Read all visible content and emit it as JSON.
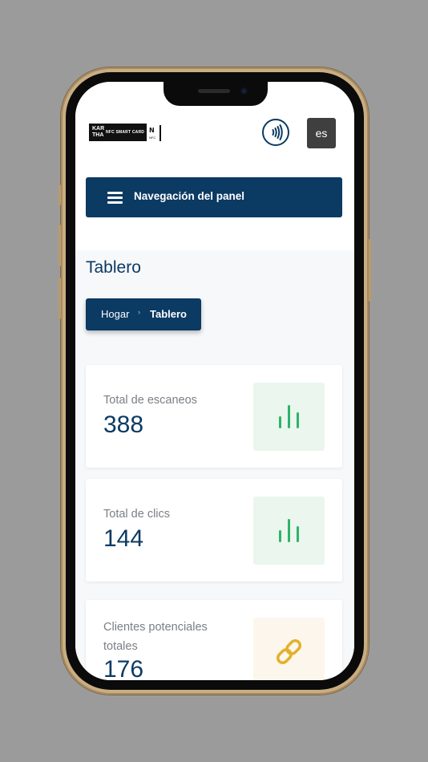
{
  "header": {
    "logo_text_line1": "KAR",
    "logo_text_line2": "THA",
    "logo_tagline": "NFC SMART CARD",
    "nfc_mark": "N",
    "nfc_mark_caption": "NFC",
    "language": "es"
  },
  "nav": {
    "title": "Navegación del panel"
  },
  "page": {
    "title": "Tablero",
    "breadcrumb": {
      "home": "Hogar",
      "separator": "›",
      "current": "Tablero"
    }
  },
  "stats": [
    {
      "label": "Total de escaneos",
      "value": "388",
      "icon": "bar-chart-icon",
      "icon_color": "#2fb36a",
      "icon_bg": "#eaf6ee"
    },
    {
      "label": "Total de clics",
      "value": "144",
      "icon": "bar-chart-icon",
      "icon_color": "#2fb36a",
      "icon_bg": "#eaf6ee"
    },
    {
      "label": "Clientes potenciales totales",
      "value": "176",
      "icon": "link-icon",
      "icon_color": "#e2b12a",
      "icon_bg": "#fdf6ec"
    }
  ],
  "colors": {
    "primary": "#0b3a63",
    "background": "#f7f8fa"
  }
}
